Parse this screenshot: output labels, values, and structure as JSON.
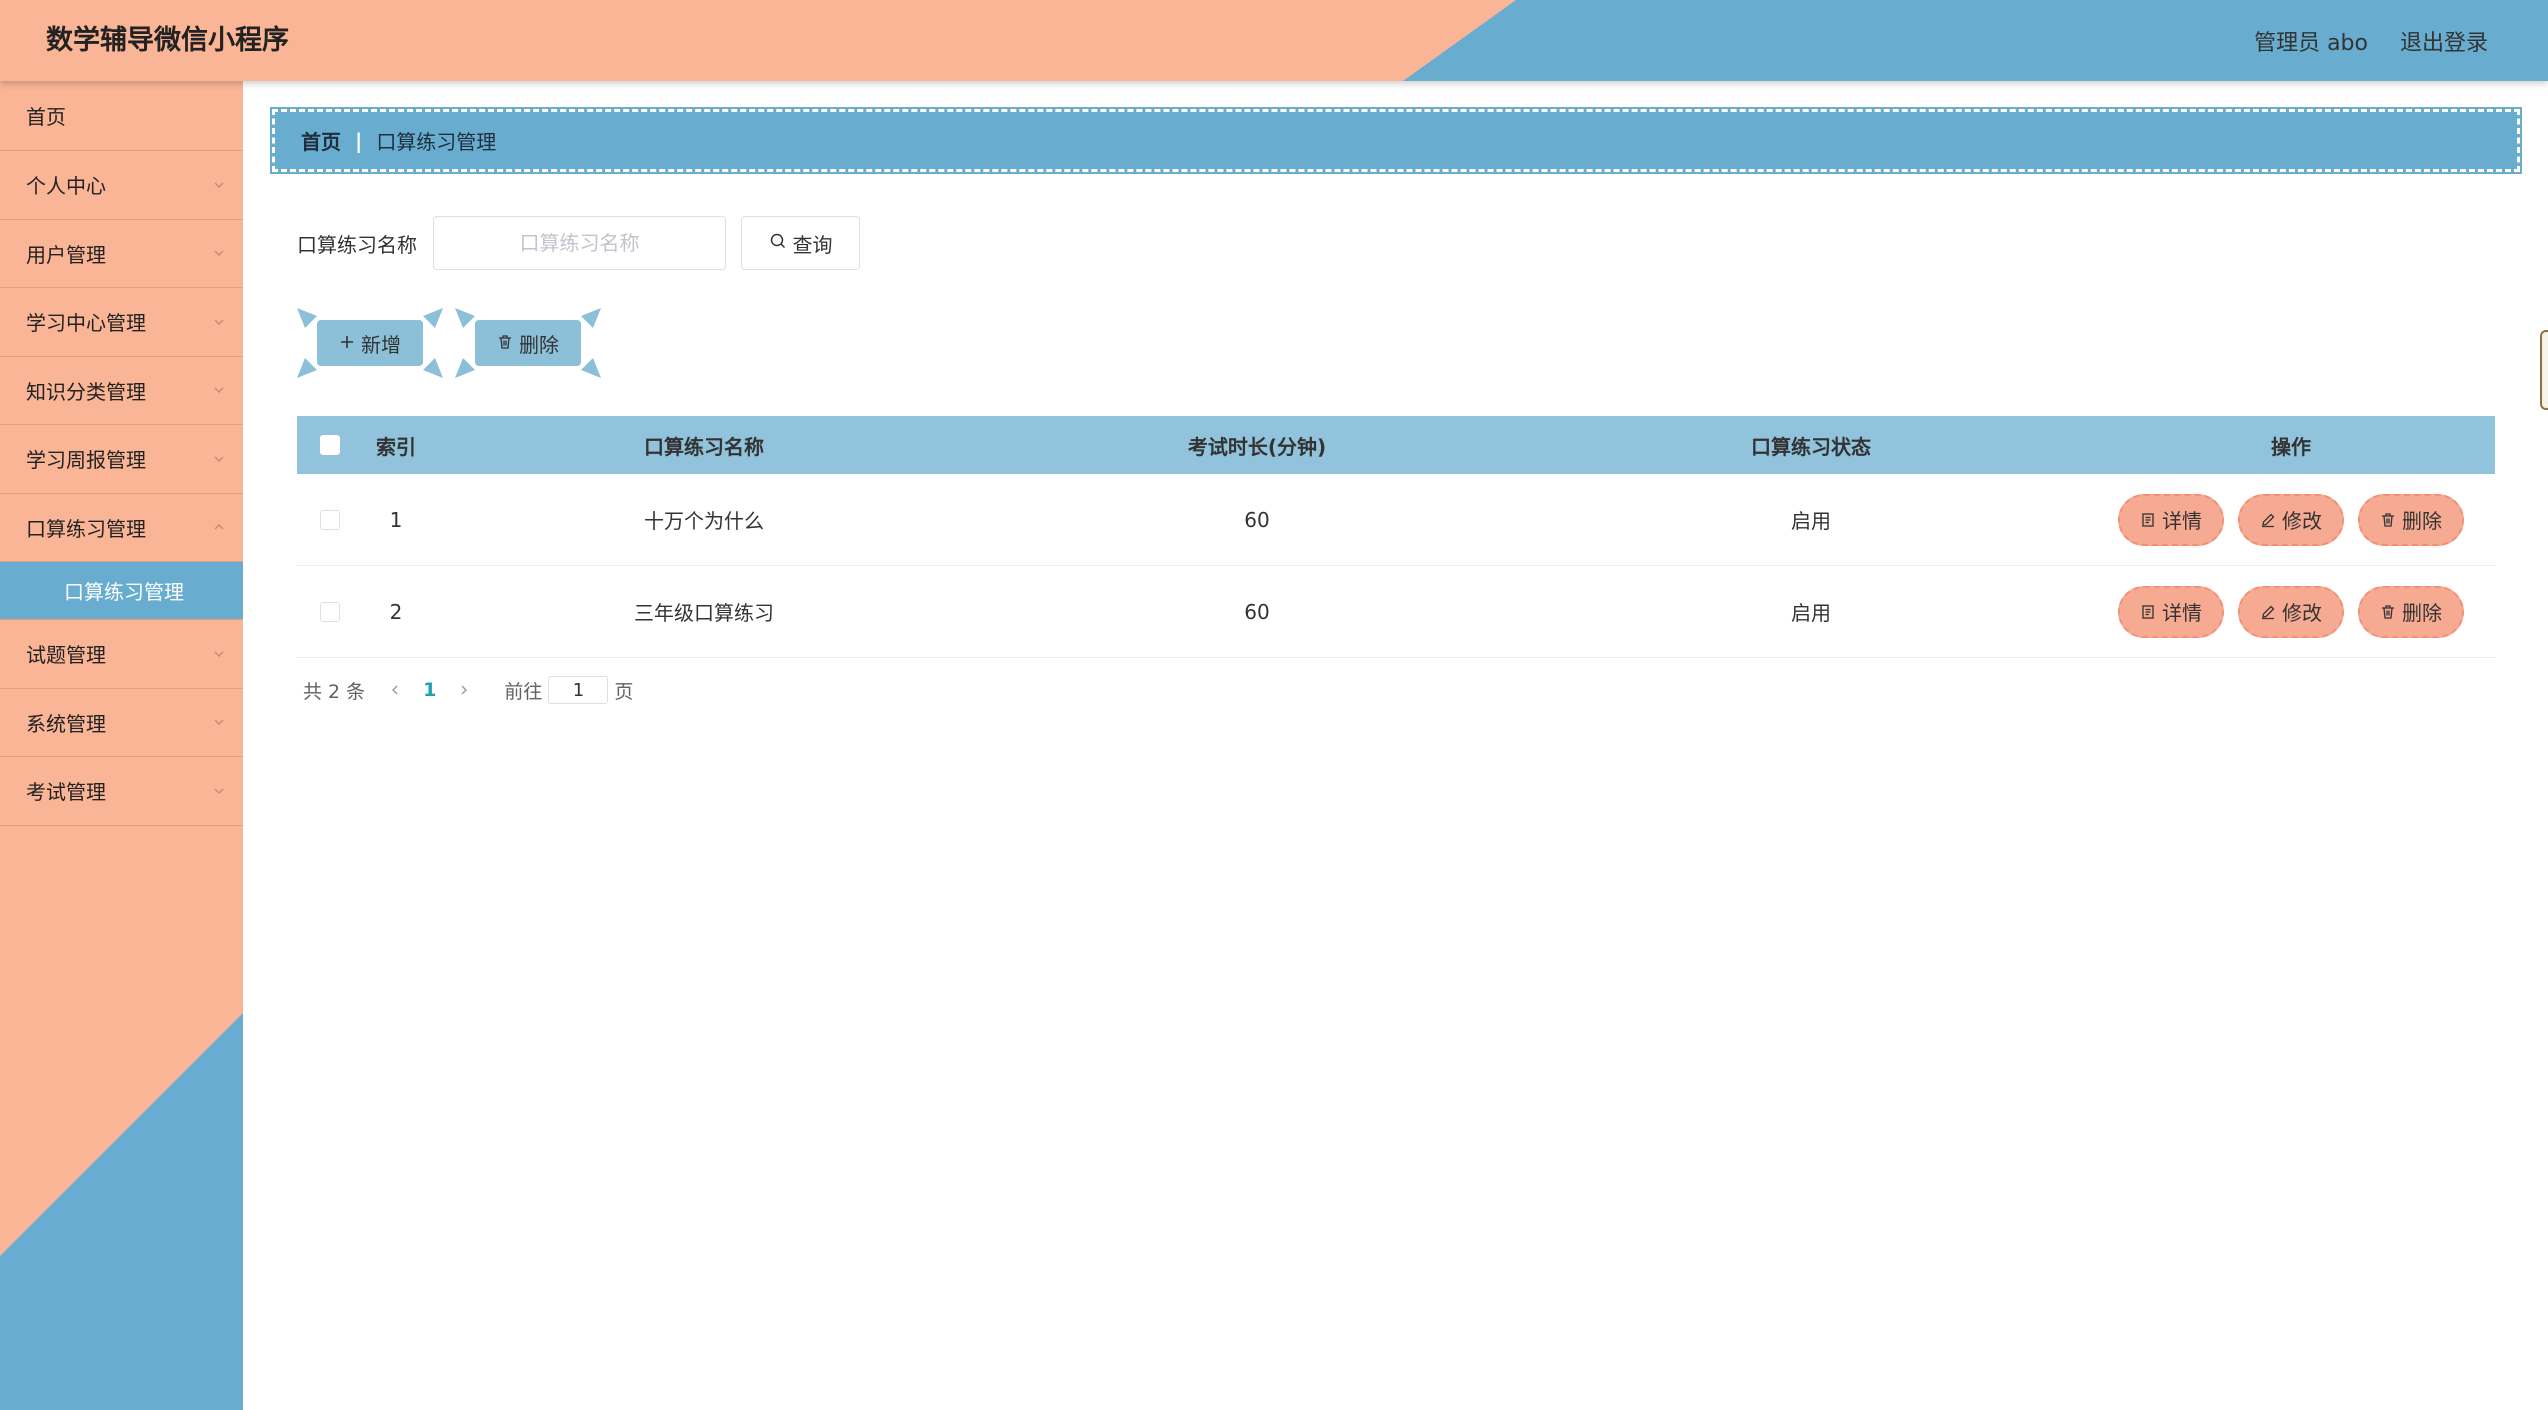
{
  "header": {
    "title": "数学辅导微信小程序",
    "user_label": "管理员 abo",
    "logout_label": "退出登录"
  },
  "sidebar": {
    "items": [
      {
        "label": "首页",
        "expandable": false
      },
      {
        "label": "个人中心",
        "expandable": true
      },
      {
        "label": "用户管理",
        "expandable": true
      },
      {
        "label": "学习中心管理",
        "expandable": true
      },
      {
        "label": "知识分类管理",
        "expandable": true
      },
      {
        "label": "学习周报管理",
        "expandable": true
      },
      {
        "label": "口算练习管理",
        "expandable": true,
        "expanded": true
      },
      {
        "label": "试题管理",
        "expandable": true
      },
      {
        "label": "系统管理",
        "expandable": true
      },
      {
        "label": "考试管理",
        "expandable": true
      }
    ],
    "active_subitem": "口算练习管理"
  },
  "breadcrumb": {
    "home": "首页",
    "separator": "|",
    "current": "口算练习管理"
  },
  "search": {
    "label": "口算练习名称",
    "placeholder": "口算练习名称",
    "value": "",
    "button_label": "查询"
  },
  "actions": {
    "add_label": "新增",
    "delete_label": "删除"
  },
  "table": {
    "columns": [
      "索引",
      "口算练习名称",
      "考试时长(分钟)",
      "口算练习状态",
      "操作"
    ],
    "rows": [
      {
        "index": "1",
        "name": "十万个为什么",
        "duration": "60",
        "status": "启用"
      },
      {
        "index": "2",
        "name": "三年级口算练习",
        "duration": "60",
        "status": "启用"
      }
    ],
    "row_actions": {
      "detail": "详情",
      "edit": "修改",
      "delete": "删除"
    }
  },
  "pagination": {
    "total_text": "共 2 条",
    "current_page": "1",
    "goto_prefix": "前往",
    "goto_value": "1",
    "goto_suffix": "页"
  },
  "colors": {
    "peach": "#fab496",
    "blue": "#68adcf",
    "table_header": "#91c3dc",
    "button_blue": "#8cbfd8",
    "op_button": "#f6aa92",
    "page_active": "#1aa3ad"
  }
}
